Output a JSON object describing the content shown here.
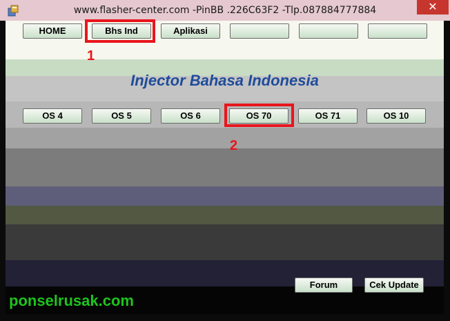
{
  "window": {
    "title": "www.flasher-center.com -PinBB .226C63F2 -Tlp.087884777884",
    "close_glyph": "✕"
  },
  "nav": {
    "buttons": [
      "HOME",
      "Bhs Ind",
      "Aplikasi",
      "",
      "",
      ""
    ]
  },
  "heading": "Injector Bahasa Indonesia",
  "os": {
    "buttons": [
      "OS 4",
      "OS 5",
      "OS 6",
      "OS 70",
      "OS 71",
      "OS 10"
    ]
  },
  "annotations": {
    "marker1": "1",
    "marker2": "2",
    "highlight_color": "#e8161c"
  },
  "footer": {
    "forum": "Forum",
    "cek_update": "Cek Update"
  },
  "watermark": "ponselrusak.com",
  "colors": {
    "heading": "#1f4c9a",
    "watermark": "#1ec41e",
    "button_gradient_bottom": "#c8e0c9"
  }
}
